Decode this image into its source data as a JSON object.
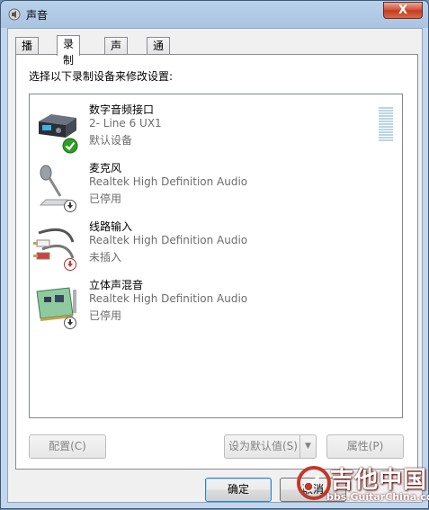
{
  "window": {
    "title": "声音",
    "close_label": "X"
  },
  "tabs": [
    {
      "label": "播放",
      "active": false
    },
    {
      "label": "录制",
      "active": true
    },
    {
      "label": "声音",
      "active": false
    },
    {
      "label": "通信",
      "active": false
    }
  ],
  "instruction": "选择以下录制设备来修改设置:",
  "devices": [
    {
      "name": "数字音频接口",
      "description": "2- Line 6 UX1",
      "status": "默认设备",
      "icon": "digital-interface-icon",
      "badge": "default-check-icon"
    },
    {
      "name": "麦克风",
      "description": "Realtek High Definition Audio",
      "status": "已停用",
      "icon": "microphone-icon",
      "badge": "disabled-arrow-icon"
    },
    {
      "name": "线路输入",
      "description": "Realtek High Definition Audio",
      "status": "未插入",
      "icon": "line-in-icon",
      "badge": "unplugged-arrow-icon"
    },
    {
      "name": "立体声混音",
      "description": "Realtek High Definition Audio",
      "status": "已停用",
      "icon": "sound-card-icon",
      "badge": "disabled-arrow-icon"
    }
  ],
  "buttons": {
    "configure": "配置(C)",
    "set_default": "设为默认值(S)",
    "properties": "属性(P)",
    "ok": "确定",
    "cancel": "取消"
  },
  "watermark": {
    "title": "吉他中国",
    "url": "bbs.GuitarChina.com"
  },
  "colors": {
    "accent": "#3c7fb1",
    "check": "#2f9e25",
    "unplugged": "#c0392b"
  }
}
